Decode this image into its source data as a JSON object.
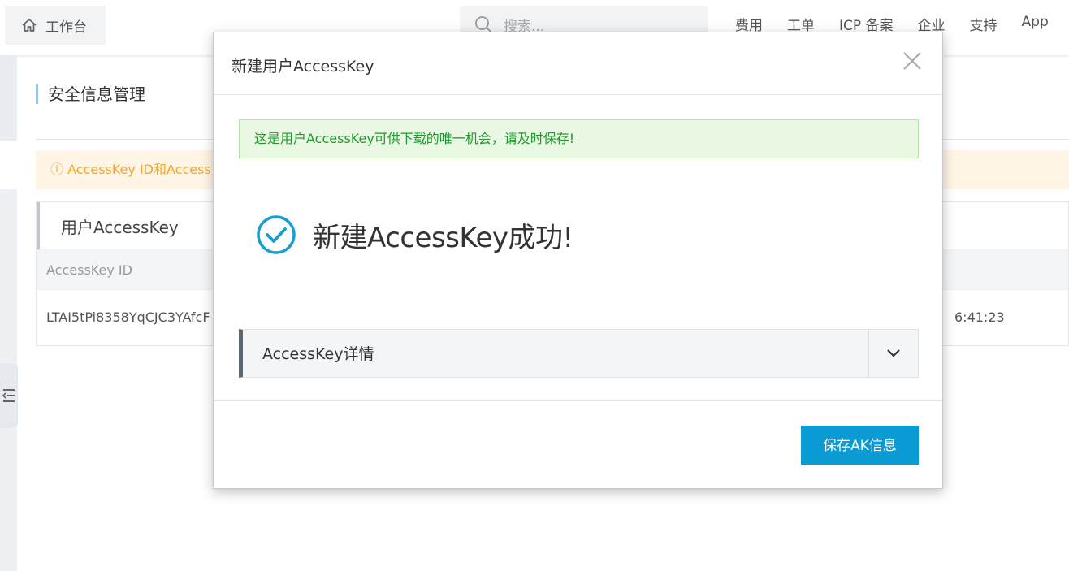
{
  "topbar": {
    "home_label": "工作台",
    "search_placeholder": "搜索...",
    "nav": [
      "费用",
      "工单",
      "ICP 备案",
      "企业",
      "支持",
      "App"
    ]
  },
  "page": {
    "title": "安全信息管理",
    "warning": "ⓘ AccessKey ID和Access",
    "card_title": "用户AccessKey",
    "column_header": "AccessKey ID",
    "row_id": "LTAI5tPi8358YqCJC3YAfcF",
    "row_time": "6:41:23"
  },
  "modal": {
    "title": "新建用户AccessKey",
    "notice": "这是用户AccessKey可供下载的唯一机会，请及时保存!",
    "success_text": "新建AccessKey成功!",
    "detail_label": "AccessKey详情",
    "save_button": "保存AK信息"
  },
  "colors": {
    "accent": "#0a9bd4",
    "success_icon": "#1a9dd0",
    "notice_text": "#1f9a2b",
    "warning_text": "#f5a623"
  },
  "icons": [
    "home-icon",
    "search-icon",
    "close-icon",
    "check-circle-icon",
    "chevron-down-icon",
    "collapse-icon"
  ]
}
